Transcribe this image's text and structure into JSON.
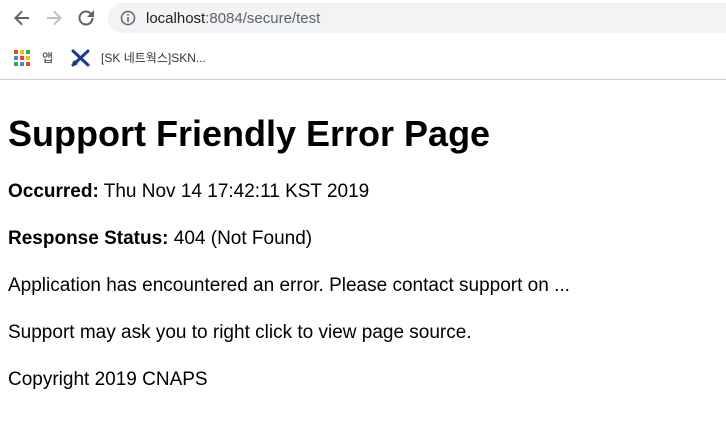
{
  "browser": {
    "url_host": "localhost",
    "url_rest": ":8084/secure/test",
    "bookmarks": [
      {
        "label": "앱",
        "icon": "apps-grid-icon"
      },
      {
        "label": "[SK 네트웍스]SKN...",
        "icon": "scissors-x-icon"
      }
    ]
  },
  "page": {
    "title": "Support Friendly Error Page",
    "occurred_label": "Occurred:",
    "occurred_value": "Thu Nov 14 17:42:11 KST 2019",
    "status_label": "Response Status:",
    "status_value": "404 (Not Found)",
    "message": "Application has encountered an error. Please contact support on ...",
    "support_note": "Support may ask you to right click to view page source.",
    "copyright": "Copyright 2019 CNAPS"
  },
  "colors": {
    "apps_grid": [
      "#ea4335",
      "#fbbc04",
      "#34a853",
      "#4285f4",
      "#ea4335",
      "#fbbc04",
      "#34a853",
      "#4285f4",
      "#ea4335"
    ],
    "bookmark_x": "#1a3a8f"
  }
}
